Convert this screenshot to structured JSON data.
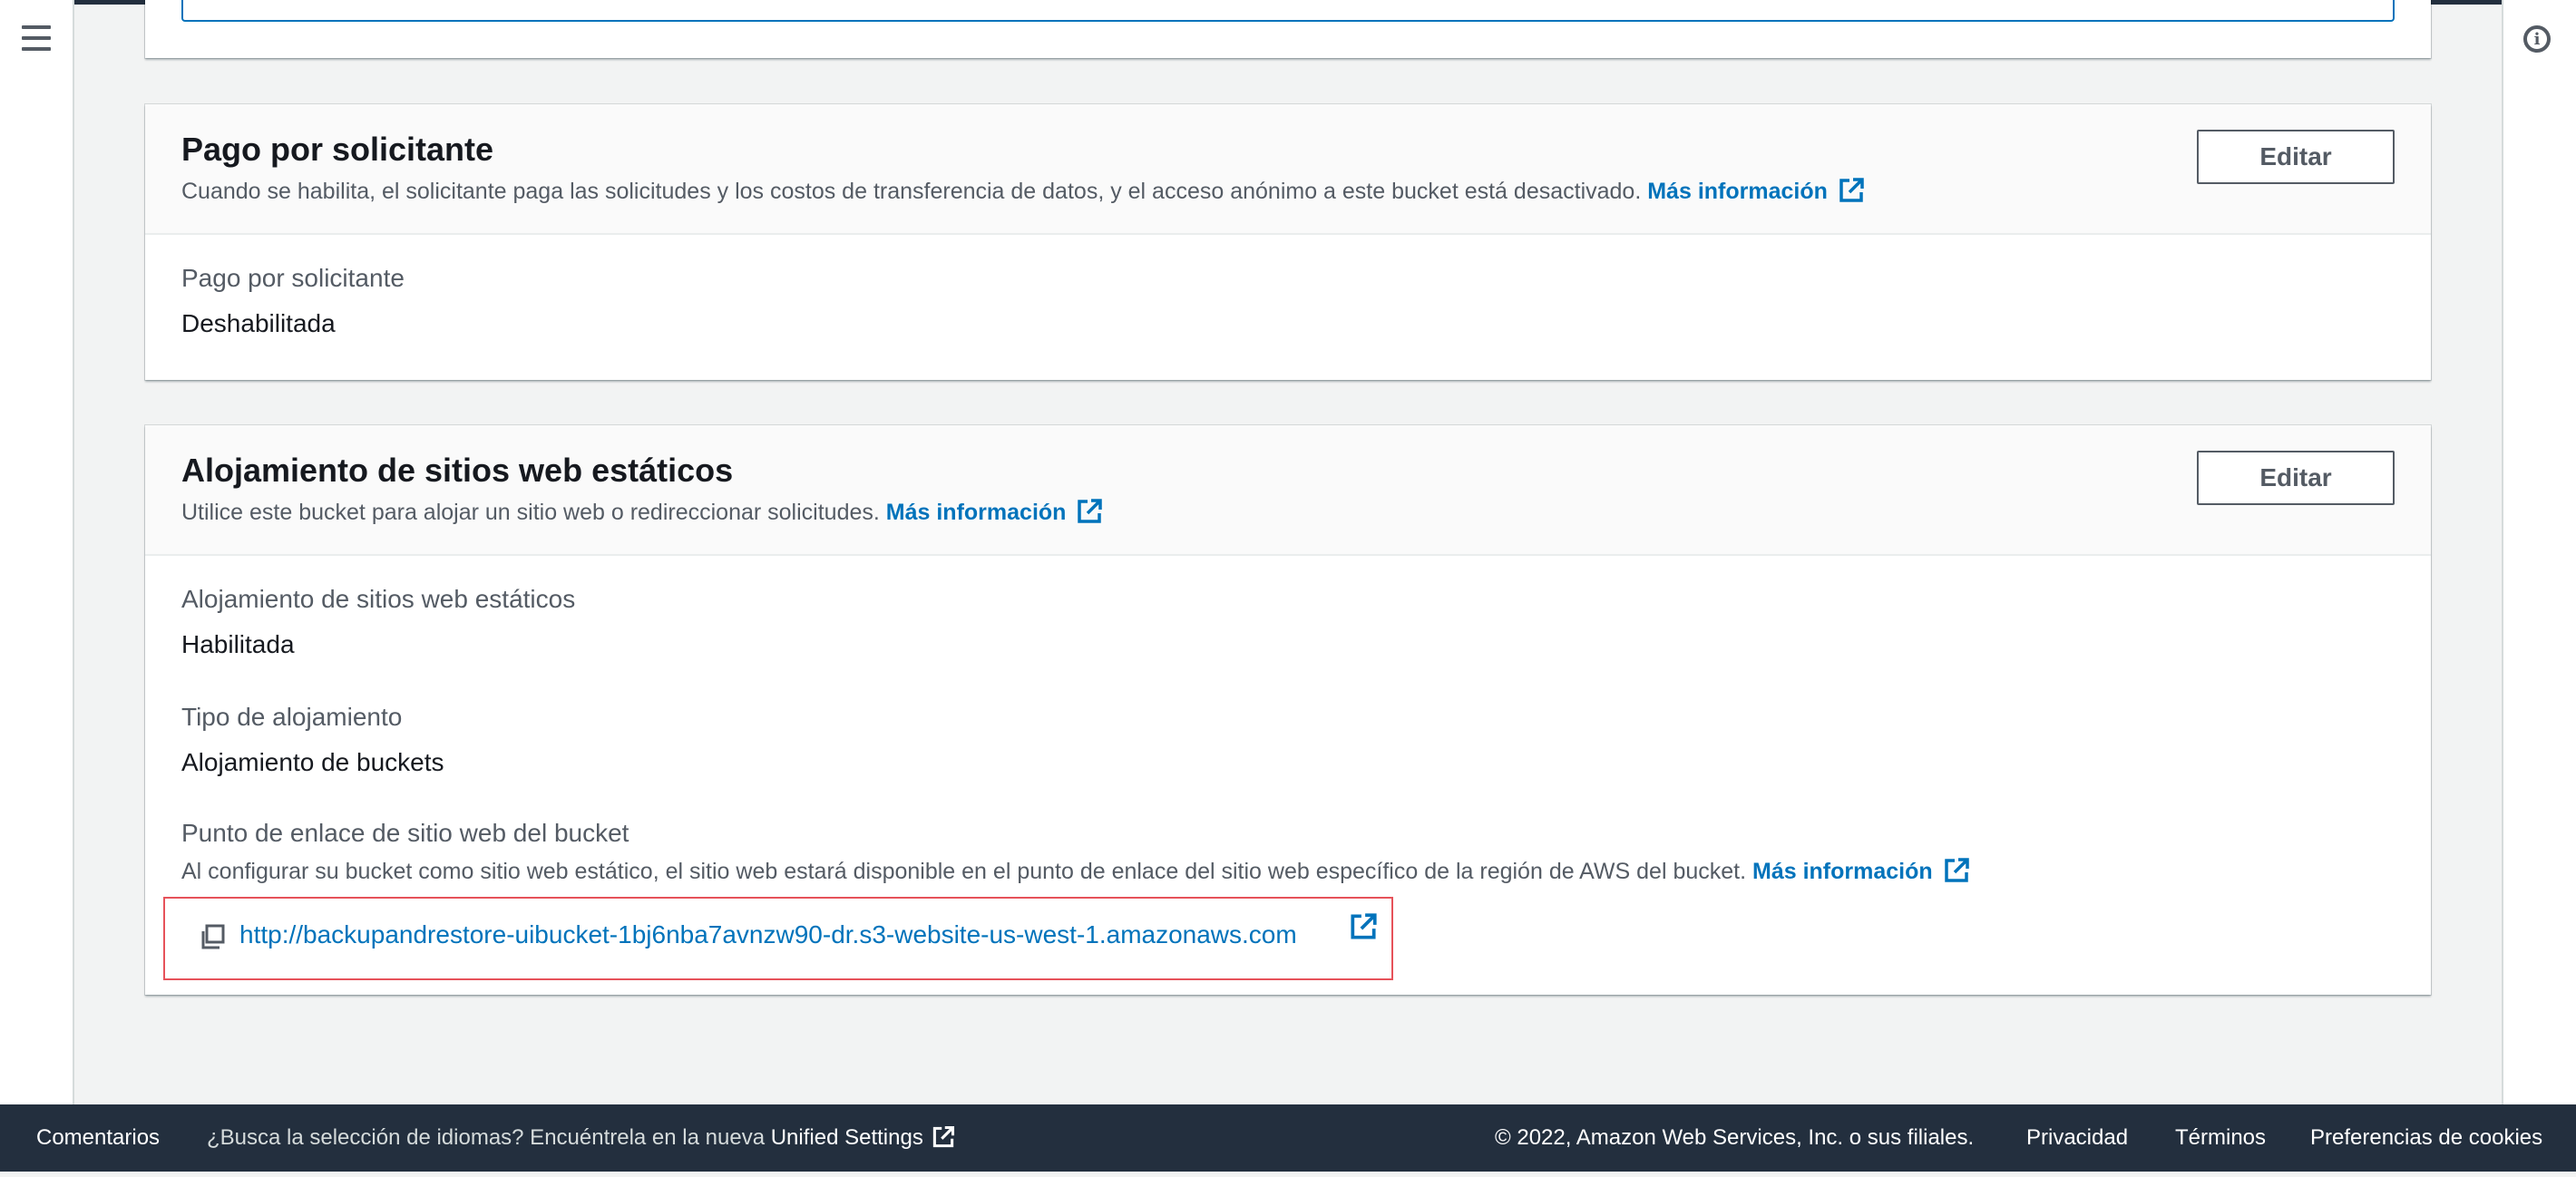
{
  "requester_pays": {
    "title": "Pago por solicitante",
    "description": "Cuando se habilita, el solicitante paga las solicitudes y los costos de transferencia de datos, y el acceso anónimo a este bucket está desactivado.",
    "learn_more": "Más información",
    "edit_label": "Editar",
    "field_label": "Pago por solicitante",
    "field_value": "Deshabilitada"
  },
  "static_website": {
    "title": "Alojamiento de sitios web estáticos",
    "description": "Utilice este bucket para alojar un sitio web o redireccionar solicitudes.",
    "learn_more": "Más información",
    "edit_label": "Editar",
    "hosting_label": "Alojamiento de sitios web estáticos",
    "hosting_value": "Habilitada",
    "type_label": "Tipo de alojamiento",
    "type_value": "Alojamiento de buckets",
    "endpoint_label": "Punto de enlace de sitio web del bucket",
    "endpoint_description": "Al configurar su bucket como sitio web estático, el sitio web estará disponible en el punto de enlace del sitio web específico de la región de AWS del bucket.",
    "endpoint_learn_more": "Más información",
    "endpoint_url": "http://backupandrestore-uibucket-1bj6nba7avnzw90-dr.s3-website-us-west-1.amazonaws.com"
  },
  "footer": {
    "feedback": "Comentarios",
    "language_prompt": "¿Busca la selección de idiomas? Encuéntrela en la nueva",
    "unified_settings": "Unified Settings",
    "copyright": "© 2022, Amazon Web Services, Inc. o sus filiales.",
    "privacy": "Privacidad",
    "terms": "Términos",
    "cookies": "Preferencias de cookies"
  },
  "icons": {
    "menu": "hamburger-menu-icon",
    "info": "info-icon",
    "external": "external-link-icon",
    "copy": "copy-icon"
  },
  "colors": {
    "link": "#0073bb",
    "footer_bg": "#232f3e",
    "highlight_border": "#e6525a",
    "focus_border": "#0073bb"
  }
}
